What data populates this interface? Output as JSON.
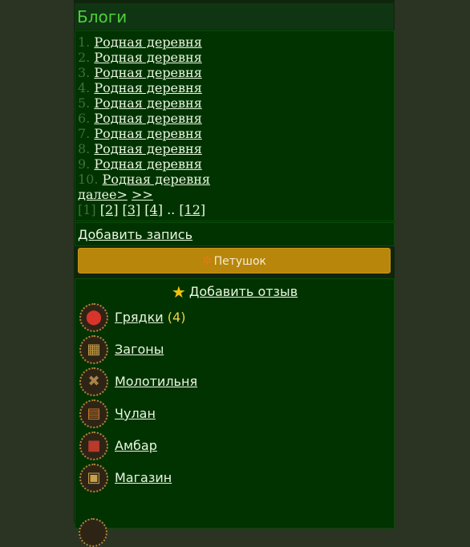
{
  "header": {
    "title": "Блоги"
  },
  "blogs": {
    "items": [
      {
        "num": "1.",
        "title": "Родная деревня"
      },
      {
        "num": "2.",
        "title": "Родная деревня"
      },
      {
        "num": "3.",
        "title": "Родная деревня"
      },
      {
        "num": "4.",
        "title": "Родная деревня"
      },
      {
        "num": "5.",
        "title": "Родная деревня"
      },
      {
        "num": "6.",
        "title": "Родная деревня"
      },
      {
        "num": "7.",
        "title": "Родная деревня"
      },
      {
        "num": "8.",
        "title": "Родная деревня"
      },
      {
        "num": "9.",
        "title": "Родная деревня"
      },
      {
        "num": "10.",
        "title": "Родная деревня"
      }
    ],
    "next_label": "далее>",
    "next2_label": ">>",
    "pager": {
      "current": "[1]",
      "pages": [
        "[2]",
        "[3]",
        "[4]"
      ],
      "ellipsis": "..",
      "last": "[12]"
    }
  },
  "add_record": {
    "label": "Добавить запись"
  },
  "rooster_button": {
    "label": "Петушок",
    "icon": "rooster-icon",
    "color": "#b8860b"
  },
  "review": {
    "label": "Добавить отзыв",
    "icon": "star-icon"
  },
  "menu": {
    "items": [
      {
        "label": "Грядки",
        "count": "(4)",
        "icon": "tomato-icon"
      },
      {
        "label": "Загоны",
        "icon": "pen-icon"
      },
      {
        "label": "Молотильня",
        "icon": "mill-icon"
      },
      {
        "label": "Чулан",
        "icon": "closet-icon"
      },
      {
        "label": "Амбар",
        "icon": "barn-icon"
      },
      {
        "label": "Магазин",
        "icon": "shop-icon"
      }
    ]
  },
  "colors": {
    "background": "#2b3323",
    "panel": "#003300",
    "title": "#4fcf3a",
    "link": "#e9f7e0",
    "muted_number": "#3f6f3f",
    "count": "#f1d24a"
  }
}
